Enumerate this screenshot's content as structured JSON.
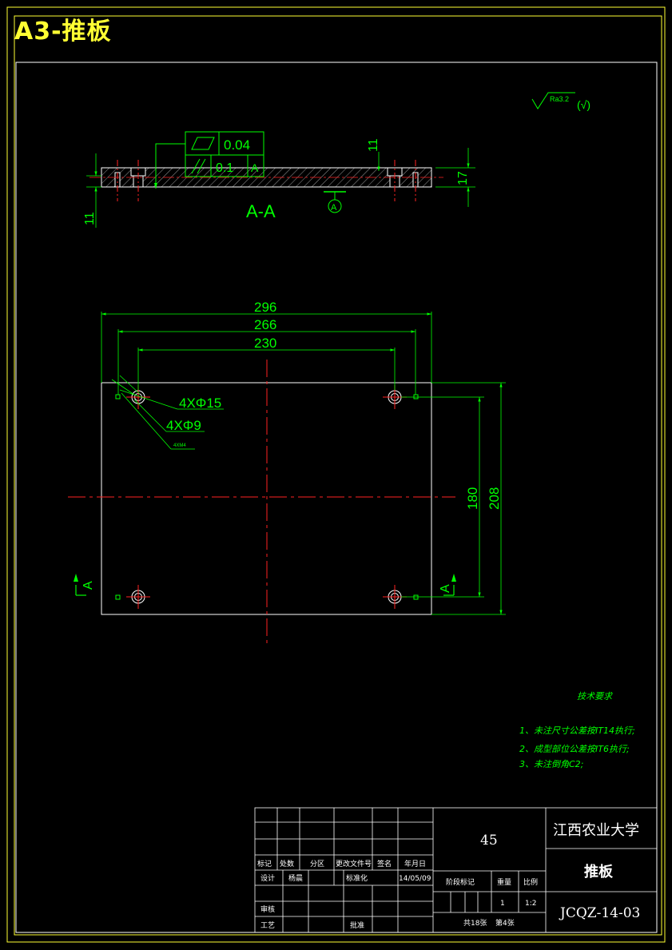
{
  "page_title": "A3-推板",
  "colors": {
    "outline": "#ffffff",
    "dimension": "#00ff00",
    "centerline": "#ff2222",
    "frame": "#ffff33",
    "hatch": "#ffffff"
  },
  "surface_finish": {
    "symbol": "Ra3.2",
    "suffix": "(√)"
  },
  "section_view": {
    "label": "A-A",
    "flatness_value": "0.04",
    "parallelism_value": "0.1",
    "datum": "A",
    "dim_thickness": "17",
    "dim_counterbore_left": "11",
    "dim_counterbore_right": "11"
  },
  "plan_view": {
    "dim_total_width": "296",
    "dim_width_2": "266",
    "dim_width_3": "230",
    "dim_height_1": "180",
    "dim_height_2": "208",
    "hole_callout_1": "4XΦ15",
    "hole_callout_2": "4XΦ9",
    "hole_callout_3": "4XM4",
    "section_mark_left": "A",
    "section_mark_right": "A"
  },
  "tech_requirements": {
    "heading": "技术要求",
    "items": [
      "1、未注尺寸公差按IT14执行;",
      "2、成型部位公差按IT6执行;",
      "3、未注倒角C2;"
    ]
  },
  "title_block": {
    "material": "45",
    "school": "江西农业大学",
    "part_name": "推板",
    "drawing_no": "JCQZ-14-03",
    "headers": [
      "标记",
      "处数",
      "分区",
      "更改文件号",
      "签名",
      "年月日"
    ],
    "design_label": "设计",
    "designer": "杨晨",
    "standardize_label": "标准化",
    "date": "14/05/09",
    "stage_label": "阶段标记",
    "weight_label": "重量",
    "scale_label": "比例",
    "weight_value": "1",
    "scale_value": "1:2",
    "review_label": "审核",
    "process_label": "工艺",
    "approve_label": "批准",
    "sheets": "共18张",
    "sheet_no": "第4张"
  }
}
